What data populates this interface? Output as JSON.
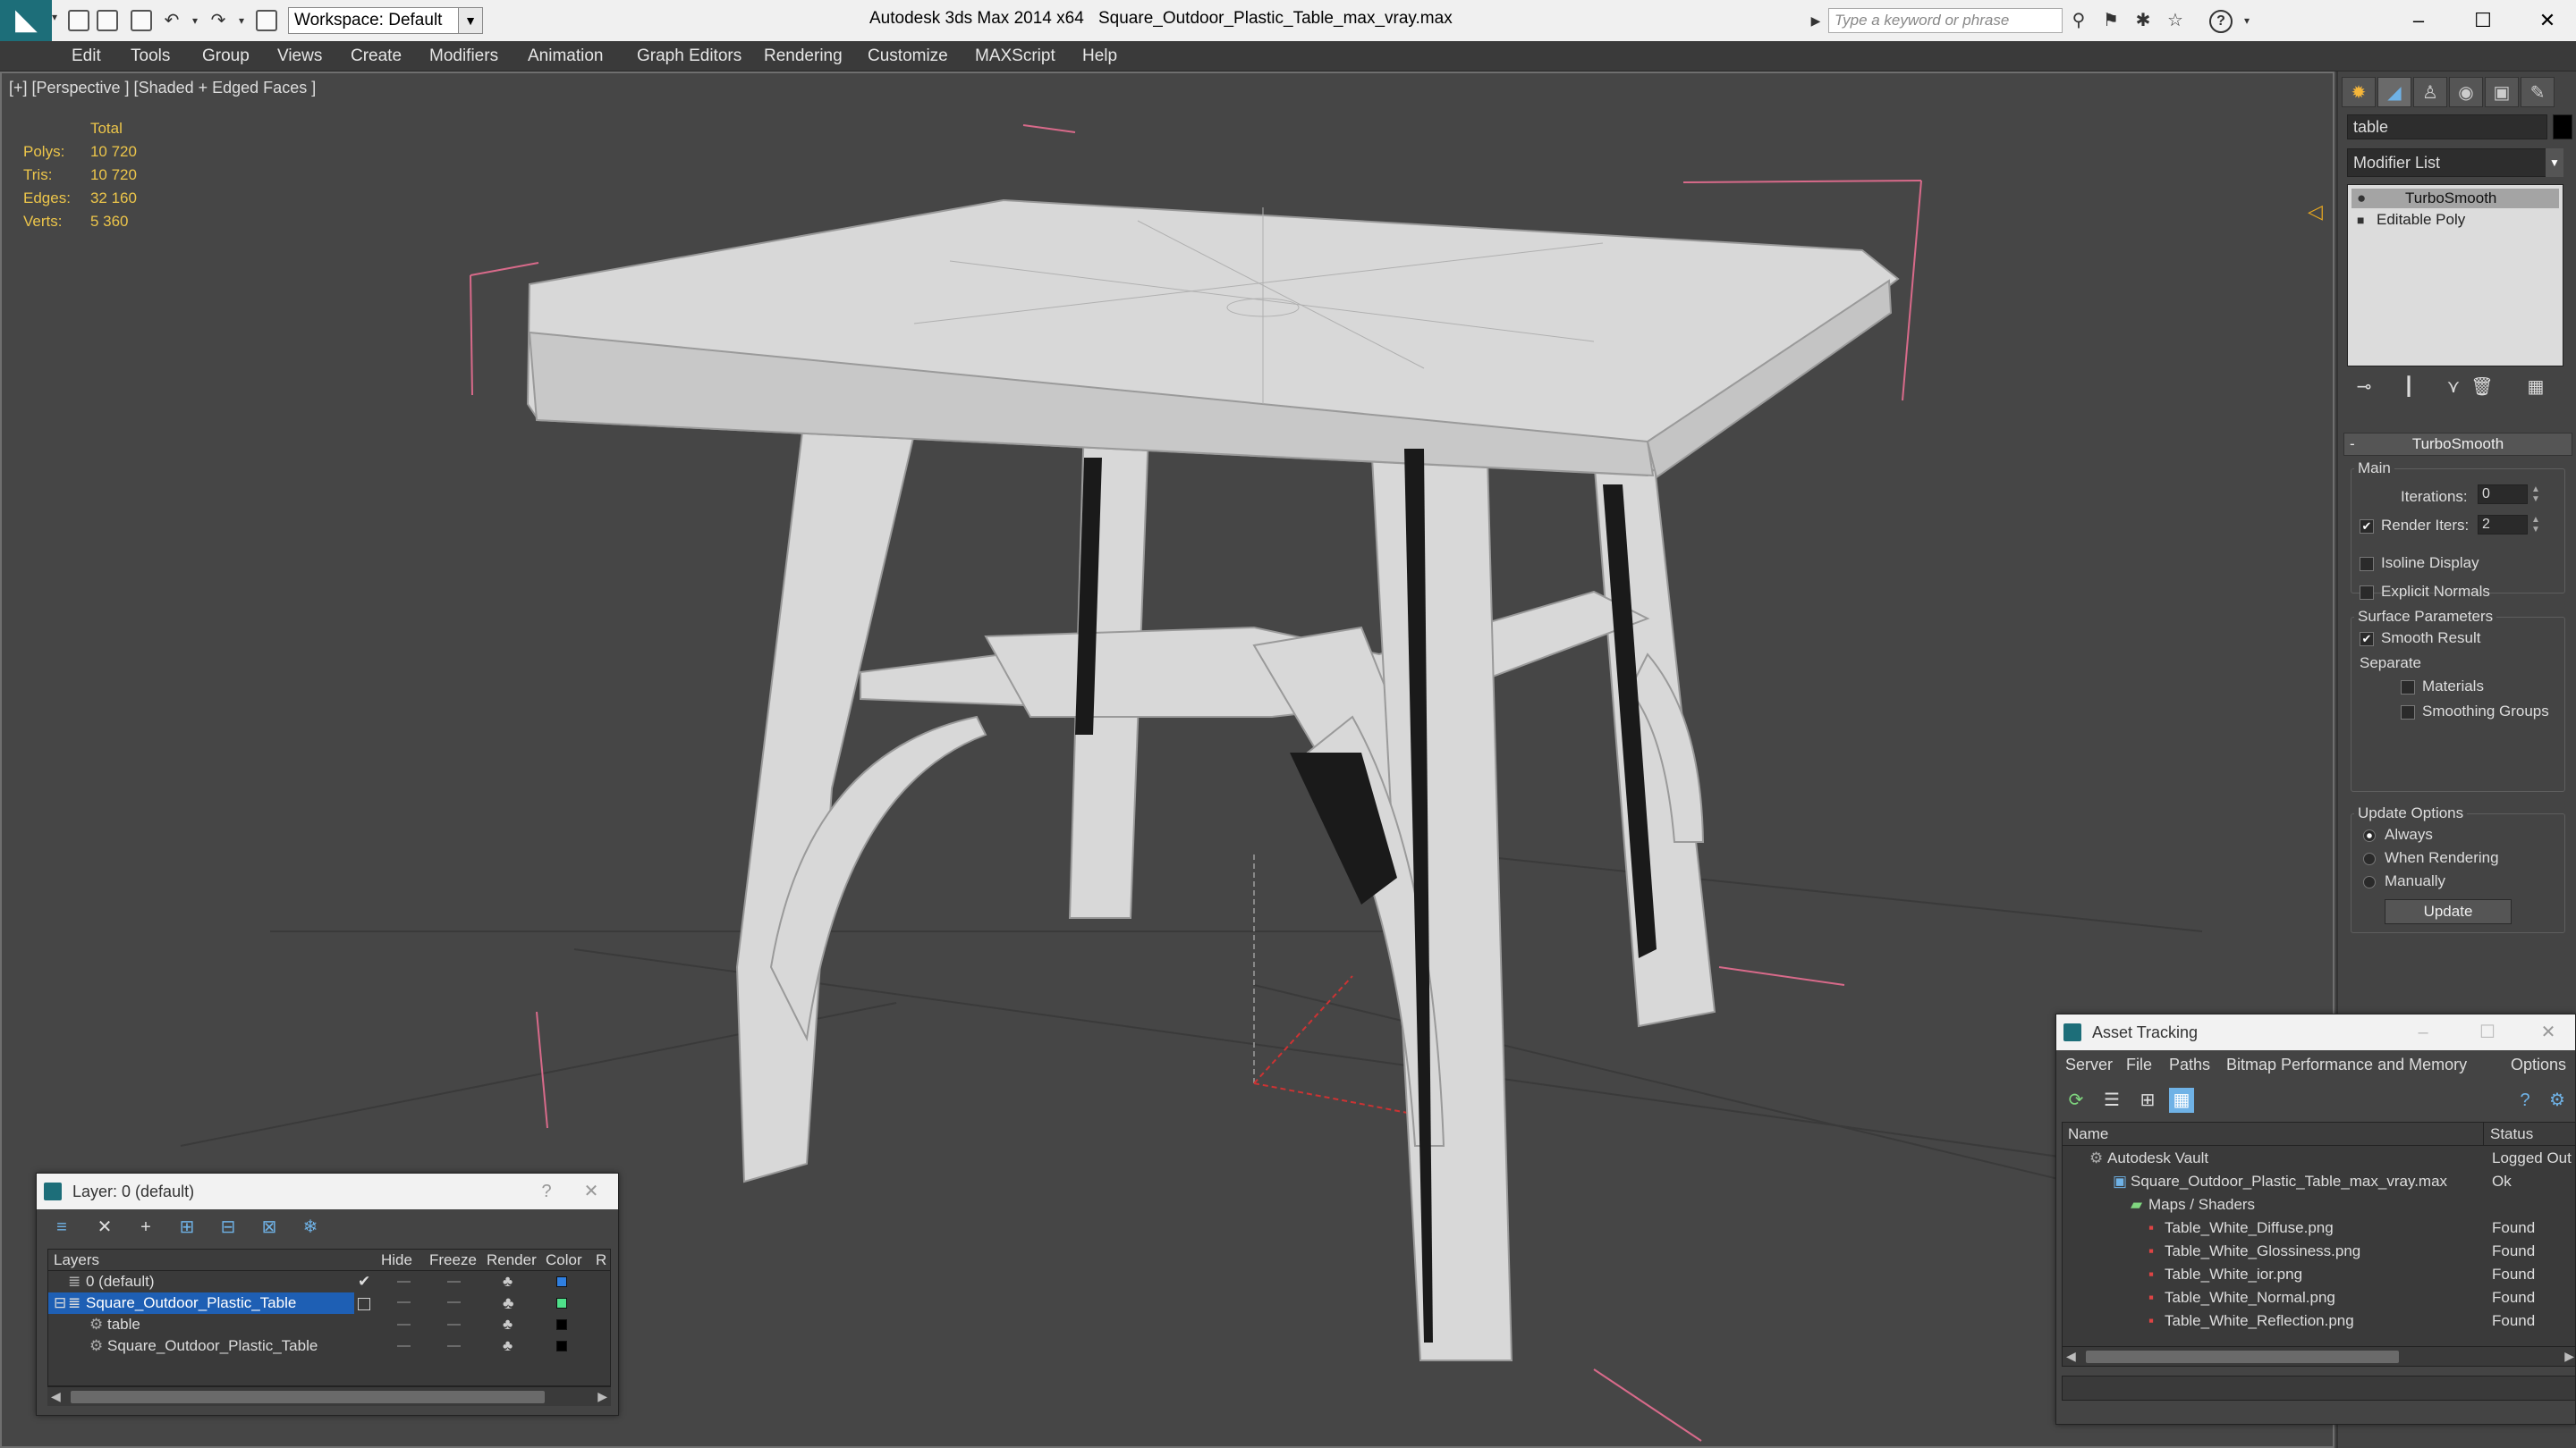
{
  "titlebar": {
    "workspace": "Workspace: Default",
    "app_title": "Autodesk 3ds Max 2014 x64",
    "file_title": "Square_Outdoor_Plastic_Table_max_vray.max",
    "search_placeholder": "Type a keyword or phrase",
    "minimize": "–",
    "maximize": "☐",
    "close": "✕"
  },
  "menu": {
    "items": [
      "Edit",
      "Tools",
      "Group",
      "Views",
      "Create",
      "Modifiers",
      "Animation",
      "Graph Editors",
      "Rendering",
      "Customize",
      "MAXScript",
      "Help"
    ]
  },
  "viewport": {
    "label": "[+] [Perspective ] [Shaded + Edged Faces ]",
    "stats": {
      "header": "Total",
      "rows": [
        {
          "label": "Polys:",
          "value": "10 720"
        },
        {
          "label": "Tris:",
          "value": "10 720"
        },
        {
          "label": "Edges:",
          "value": "32 160"
        },
        {
          "label": "Verts:",
          "value": "5 360"
        }
      ]
    }
  },
  "command_panel": {
    "object_name": "table",
    "modifier_list": "Modifier List",
    "stack": [
      "TurboSmooth",
      "Editable Poly"
    ],
    "rollout_title": "TurboSmooth",
    "main_group": "Main",
    "iterations_label": "Iterations:",
    "iterations_value": "0",
    "render_iters_label": "Render Iters:",
    "render_iters_value": "2",
    "isoline_display": "Isoline Display",
    "explicit_normals": "Explicit Normals",
    "surface_group": "Surface Parameters",
    "smooth_result": "Smooth Result",
    "separate": "Separate",
    "materials": "Materials",
    "smoothing_groups": "Smoothing Groups",
    "update_group": "Update Options",
    "always": "Always",
    "when_rendering": "When Rendering",
    "manually": "Manually",
    "update_button": "Update"
  },
  "layer_window": {
    "title": "Layer: 0 (default)",
    "help": "?",
    "close": "✕",
    "columns": [
      "Layers",
      "Hide",
      "Freeze",
      "Render",
      "Color",
      "R"
    ],
    "rows": [
      {
        "name": "0 (default)",
        "indent": 1,
        "color": "#2f7fe0"
      },
      {
        "name": "Square_Outdoor_Plastic_Table",
        "indent": 1,
        "color": "#4fe08a",
        "selected": true
      },
      {
        "name": "table",
        "indent": 2,
        "color": "#000000"
      },
      {
        "name": "Square_Outdoor_Plastic_Table",
        "indent": 2,
        "color": "#000000"
      }
    ]
  },
  "asset_window": {
    "title": "Asset Tracking",
    "menus": [
      "Server",
      "File",
      "Paths",
      "Bitmap Performance and Memory",
      "Options"
    ],
    "columns": [
      "Name",
      "Status"
    ],
    "rows": [
      {
        "name": "Autodesk Vault",
        "status": "Logged Out",
        "indent": 1
      },
      {
        "name": "Square_Outdoor_Plastic_Table_max_vray.max",
        "status": "Ok",
        "indent": 2
      },
      {
        "name": "Maps / Shaders",
        "status": "",
        "indent": 3
      },
      {
        "name": "Table_White_Diffuse.png",
        "status": "Found",
        "indent": 4
      },
      {
        "name": "Table_White_Glossiness.png",
        "status": "Found",
        "indent": 4
      },
      {
        "name": "Table_White_ior.png",
        "status": "Found",
        "indent": 4
      },
      {
        "name": "Table_White_Normal.png",
        "status": "Found",
        "indent": 4
      },
      {
        "name": "Table_White_Reflection.png",
        "status": "Found",
        "indent": 4
      }
    ]
  }
}
